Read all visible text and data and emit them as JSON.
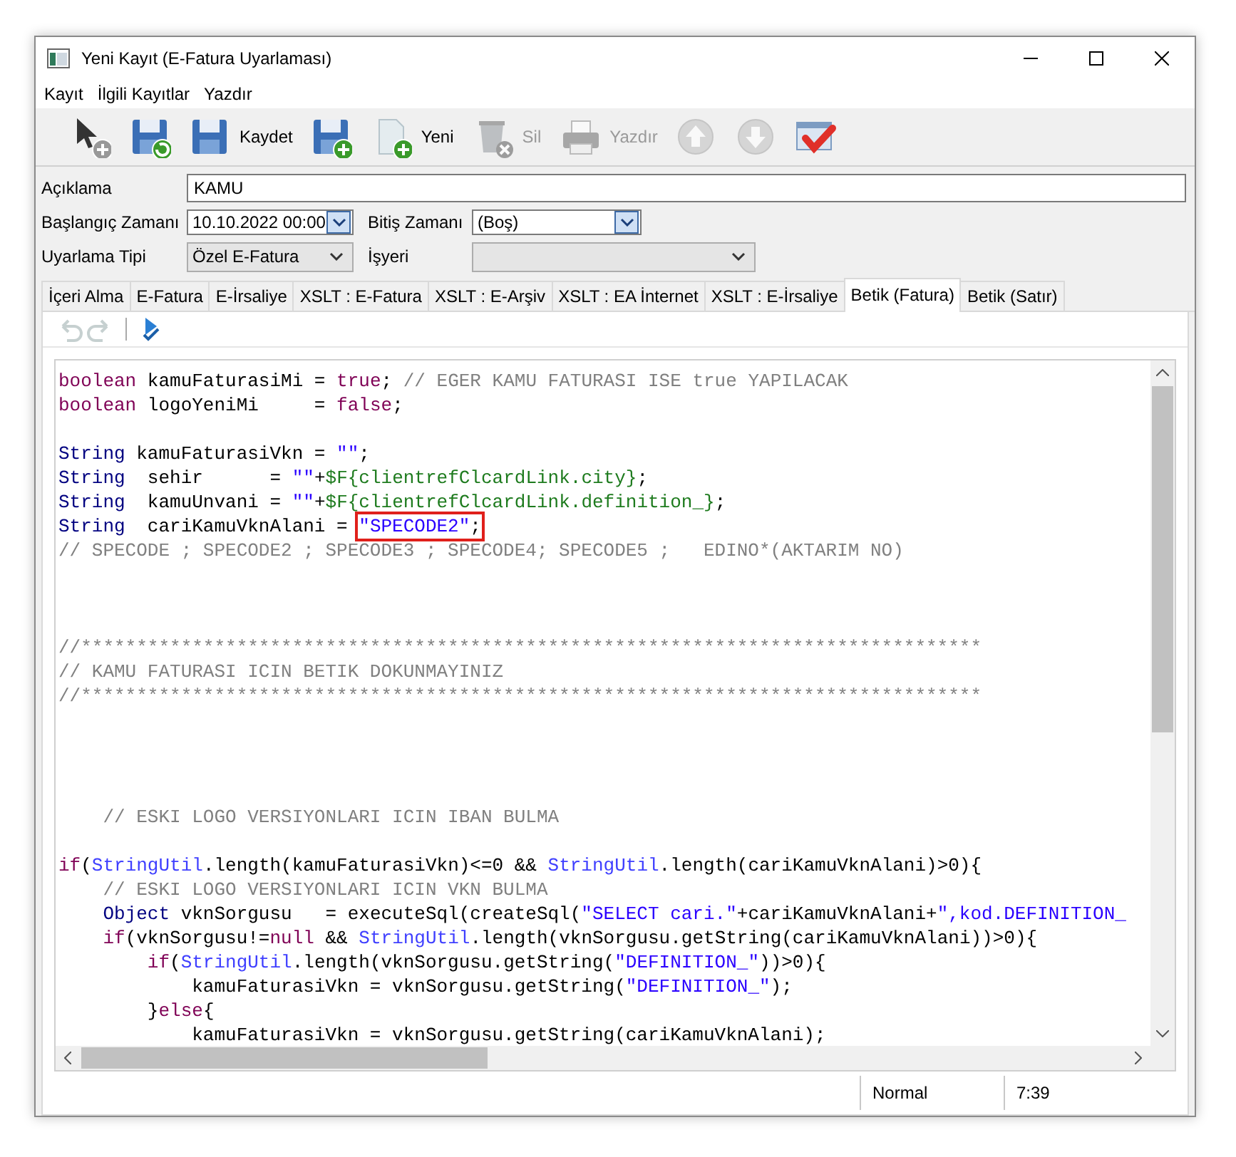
{
  "window": {
    "title": "Yeni Kayıt (E-Fatura Uyarlaması)"
  },
  "menu": [
    "Kayıt",
    "İlgili Kayıtlar",
    "Yazdır"
  ],
  "toolbar": [
    {
      "disabled": false
    },
    {
      "disabled": false
    },
    {
      "label": "Kaydet",
      "disabled": false
    },
    {
      "disabled": false
    },
    {
      "label": "Yeni",
      "disabled": false
    },
    {
      "label": "Sil",
      "disabled": true
    },
    {
      "label": "Yazdır",
      "disabled": true
    },
    {
      "disabled": true
    },
    {
      "disabled": true
    },
    {
      "disabled": false
    }
  ],
  "form": {
    "description": {
      "label": "Açıklama",
      "value": "KAMU"
    },
    "rows": [
      [
        {
          "label": "Başlangıç Zamanı",
          "value": "10.10.2022 00:00",
          "kind": "date"
        },
        {
          "label": "Bitiş Zamanı",
          "value": "(Boş)",
          "kind": "date"
        }
      ],
      [
        {
          "label": "Uyarlama Tipi",
          "value": "Özel E-Fatura",
          "kind": "select"
        },
        {
          "label": "İşyeri",
          "kind": "select"
        }
      ]
    ]
  },
  "tabs": [
    {
      "label": "İçeri Alma",
      "selected": false
    },
    {
      "label": "E-Fatura",
      "selected": false
    },
    {
      "label": "E-İrsaliye",
      "selected": false
    },
    {
      "label": "XSLT : E-Fatura",
      "selected": false
    },
    {
      "label": "XSLT : E-Arşiv",
      "selected": false
    },
    {
      "label": "XSLT : EA İnternet",
      "selected": false
    },
    {
      "label": "XSLT : E-İrsaliye",
      "selected": false
    },
    {
      "label": "Betik (Fatura)",
      "selected": true
    },
    {
      "label": "Betik (Satır)",
      "selected": false
    }
  ],
  "editor_toolbar": [
    {
      "disabled": true
    },
    {
      "disabled": true
    },
    {
      "disabled": false
    }
  ],
  "code_lines": [
    {
      "kind": "code",
      "tokens": [
        {
          "kind": "kw",
          "text": "boolean"
        },
        {
          "kind": "plain",
          "text": " kamuFaturasiMi = "
        },
        {
          "kind": "kw",
          "text": "true"
        },
        {
          "kind": "plain",
          "text": "; "
        },
        {
          "kind": "cmt",
          "text": "// EGER KAMU FATURASI ISE true YAPILACAK"
        }
      ]
    },
    {
      "kind": "code",
      "tokens": [
        {
          "kind": "kw",
          "text": "boolean"
        },
        {
          "kind": "plain",
          "text": " logoYeniMi     = "
        },
        {
          "kind": "kw",
          "text": "false"
        },
        {
          "kind": "plain",
          "text": ";"
        }
      ]
    },
    {
      "kind": "blank"
    },
    {
      "kind": "code",
      "tokens": [
        {
          "kind": "type",
          "text": "String"
        },
        {
          "kind": "plain",
          "text": " kamuFaturasiVkn = "
        },
        {
          "kind": "str",
          "text": "\"\""
        },
        {
          "kind": "plain",
          "text": ";"
        }
      ]
    },
    {
      "kind": "code",
      "tokens": [
        {
          "kind": "type",
          "text": "String"
        },
        {
          "kind": "plain",
          "text": "  sehir      = "
        },
        {
          "kind": "str",
          "text": "\"\""
        },
        {
          "kind": "plain",
          "text": "+"
        },
        {
          "kind": "var",
          "text": "$F{clientrefClcardLink.city}"
        },
        {
          "kind": "plain",
          "text": ";"
        }
      ]
    },
    {
      "kind": "code",
      "tokens": [
        {
          "kind": "type",
          "text": "String"
        },
        {
          "kind": "plain",
          "text": "  kamuUnvani = "
        },
        {
          "kind": "str",
          "text": "\"\""
        },
        {
          "kind": "plain",
          "text": "+"
        },
        {
          "kind": "var",
          "text": "$F{clientrefClcardLink.definition_}"
        },
        {
          "kind": "plain",
          "text": ";"
        }
      ]
    },
    {
      "kind": "code",
      "tokens": [
        {
          "kind": "type",
          "text": "String"
        },
        {
          "kind": "plain",
          "text": "  cariKamuVknAlani = "
        },
        {
          "kind": "boxed",
          "parts": [
            {
              "kind": "str",
              "text": "\"SPECODE2\""
            },
            {
              "kind": "plain",
              "text": ";"
            }
          ]
        }
      ]
    },
    {
      "kind": "code",
      "tokens": [
        {
          "kind": "cmt",
          "text": "// SPECODE ; SPECODE2 ; SPECODE3 ; SPECODE4; SPECODE5 ;   EDINO*(AKTARIM NO)"
        }
      ]
    },
    {
      "kind": "blank"
    },
    {
      "kind": "blank"
    },
    {
      "kind": "blank"
    },
    {
      "kind": "code",
      "tokens": [
        {
          "kind": "cmt",
          "text": "//*********************************************************************************"
        }
      ]
    },
    {
      "kind": "code",
      "tokens": [
        {
          "kind": "cmt",
          "text": "// KAMU FATURASI ICIN BETIK DOKUNMAYINIZ"
        }
      ]
    },
    {
      "kind": "code",
      "tokens": [
        {
          "kind": "cmt",
          "text": "//*********************************************************************************"
        }
      ]
    },
    {
      "kind": "blank"
    },
    {
      "kind": "blank"
    },
    {
      "kind": "blank"
    },
    {
      "kind": "blank"
    },
    {
      "kind": "code",
      "tokens": [
        {
          "kind": "cmt",
          "text": "    // ESKI LOGO VERSIYONLARI ICIN IBAN BULMA"
        }
      ]
    },
    {
      "kind": "blank"
    },
    {
      "kind": "code",
      "tokens": [
        {
          "kind": "kw",
          "text": "if"
        },
        {
          "kind": "plain",
          "text": "("
        },
        {
          "kind": "cls",
          "text": "StringUtil"
        },
        {
          "kind": "plain",
          "text": ".length(kamuFaturasiVkn)<=0 && "
        },
        {
          "kind": "cls",
          "text": "StringUtil"
        },
        {
          "kind": "plain",
          "text": ".length(cariKamuVknAlani)>0){"
        }
      ]
    },
    {
      "kind": "code",
      "tokens": [
        {
          "kind": "cmt",
          "text": "    // ESKI LOGO VERSIYONLARI ICIN VKN BULMA"
        }
      ]
    },
    {
      "kind": "code",
      "tokens": [
        {
          "kind": "type",
          "text": "    Object"
        },
        {
          "kind": "plain",
          "text": " vknSorgusu   = executeSql(createSql("
        },
        {
          "kind": "str",
          "text": "\"SELECT cari.\""
        },
        {
          "kind": "plain",
          "text": "+cariKamuVknAlani+"
        },
        {
          "kind": "str",
          "text": "\",kod.DEFINITION_"
        }
      ]
    },
    {
      "kind": "code",
      "tokens": [
        {
          "kind": "kw",
          "text": "    if"
        },
        {
          "kind": "plain",
          "text": "(vknSorgusu!="
        },
        {
          "kind": "kw",
          "text": "null"
        },
        {
          "kind": "plain",
          "text": " && "
        },
        {
          "kind": "cls",
          "text": "StringUtil"
        },
        {
          "kind": "plain",
          "text": ".length(vknSorgusu.getString(cariKamuVknAlani))>0){"
        }
      ]
    },
    {
      "kind": "code",
      "tokens": [
        {
          "kind": "kw",
          "text": "        if"
        },
        {
          "kind": "plain",
          "text": "("
        },
        {
          "kind": "cls",
          "text": "StringUtil"
        },
        {
          "kind": "plain",
          "text": ".length(vknSorgusu.getString("
        },
        {
          "kind": "str",
          "text": "\"DEFINITION_\""
        },
        {
          "kind": "plain",
          "text": "))>0){"
        }
      ]
    },
    {
      "kind": "code",
      "tokens": [
        {
          "kind": "plain",
          "text": "            kamuFaturasiVkn = vknSorgusu.getString("
        },
        {
          "kind": "str",
          "text": "\"DEFINITION_\""
        },
        {
          "kind": "plain",
          "text": ");"
        }
      ]
    },
    {
      "kind": "code",
      "tokens": [
        {
          "kind": "plain",
          "text": "        }"
        },
        {
          "kind": "kw",
          "text": "else"
        },
        {
          "kind": "plain",
          "text": "{"
        }
      ]
    },
    {
      "kind": "code",
      "tokens": [
        {
          "kind": "plain",
          "text": "            kamuFaturasiVkn = vknSorgusu.getString(cariKamuVknAlani);"
        }
      ]
    }
  ],
  "status_bar": [
    "Normal",
    "7:39"
  ]
}
